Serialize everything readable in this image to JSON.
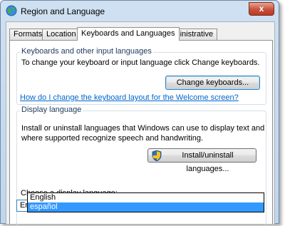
{
  "window": {
    "title": "Region and Language",
    "close_glyph": "x"
  },
  "tabs": [
    {
      "label": "Formats"
    },
    {
      "label": "Location"
    },
    {
      "label": "Keyboards and Languages"
    },
    {
      "label": "Administrative"
    }
  ],
  "keyboards": {
    "title": "Keyboards and other input languages",
    "description": "To change your keyboard or input language click Change keyboards.",
    "change_button": "Change keyboards...",
    "help_link": "How do I change the keyboard layout for the Welcome screen?"
  },
  "display": {
    "title": "Display language",
    "description_line1": "Install or uninstall languages that Windows can use to display text and",
    "description_line2": "where supported recognize speech and handwriting.",
    "install_button": "Install/uninstall languages...",
    "choose_label": "Choose a display language:",
    "selected": "English",
    "options": [
      "English",
      "español"
    ],
    "highlighted_option": "español"
  },
  "colors": {
    "link": "#0066cc",
    "selection": "#3399ff",
    "group_title": "#1e395b"
  }
}
